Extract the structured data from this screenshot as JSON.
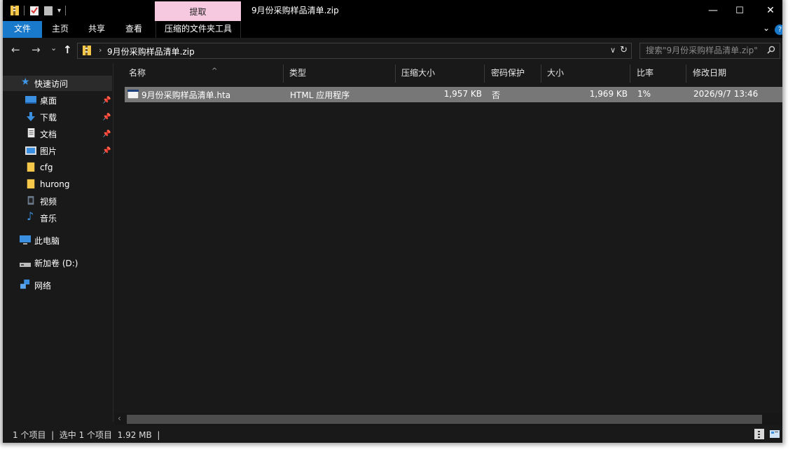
{
  "window": {
    "title": "9月份采购样品清单.zip",
    "contextual_tab_header": "提取",
    "controls": {
      "minimize": "—",
      "maximize": "☐",
      "close": "✕"
    }
  },
  "ribbon": {
    "tabs": [
      "文件",
      "主页",
      "共享",
      "查看",
      "压缩的文件夹工具"
    ],
    "help": "?"
  },
  "navigation": {
    "back": "←",
    "forward": "→",
    "recent": "⌄",
    "up": "↑",
    "address": "9月份采购样品清单.zip",
    "search_placeholder": "搜索\"9月份采购样品清单.zip\""
  },
  "sidebar": {
    "quick_access": "快速访问",
    "items": [
      {
        "label": "桌面",
        "icon": "desktop-icon",
        "pinned": true
      },
      {
        "label": "下载",
        "icon": "download-icon",
        "pinned": true
      },
      {
        "label": "文档",
        "icon": "document-icon",
        "pinned": true
      },
      {
        "label": "图片",
        "icon": "pictures-icon",
        "pinned": true
      },
      {
        "label": "cfg",
        "icon": "folder-icon",
        "pinned": false
      },
      {
        "label": "hurong",
        "icon": "folder-icon",
        "pinned": false
      },
      {
        "label": "视频",
        "icon": "video-icon",
        "pinned": false
      },
      {
        "label": "音乐",
        "icon": "music-icon",
        "pinned": false
      }
    ],
    "this_pc": "此电脑",
    "drive": "新加卷 (D:)",
    "network": "网络"
  },
  "columns": [
    "名称",
    "类型",
    "压缩大小",
    "密码保护",
    "大小",
    "比率",
    "修改日期"
  ],
  "files": [
    {
      "name": "9月份采购样品清单.hta",
      "type": "HTML 应用程序",
      "compressed_size": "1,957 KB",
      "password_protected": "否",
      "size": "1,969 KB",
      "ratio": "1%",
      "modified": "2026/9/7 13:46"
    }
  ],
  "status": {
    "text": "1 个项目  |  选中 1 个项目  1.92 MB  |"
  },
  "colors": {
    "window_bg": "#191919",
    "titlebar_bg": "#000000",
    "file_tab": "#1979ca",
    "contextual_tab": "#f7c9e0",
    "selection": "#777777"
  }
}
